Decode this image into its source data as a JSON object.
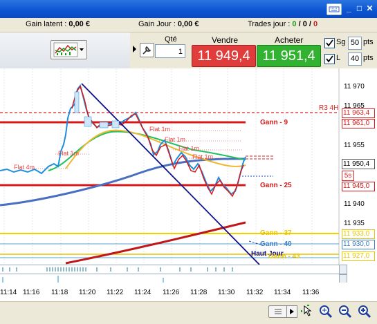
{
  "window": {
    "keyboard_icon": "keyboard-icon",
    "minimize": "_",
    "maximize": "□",
    "close": "✕"
  },
  "status": {
    "gain_latent_label": "Gain latent :",
    "gain_latent_value": "0,00 €",
    "gain_jour_label": "Gain Jour :",
    "gain_jour_value": "0,00 €",
    "trades_label": "Trades jour :",
    "trades_a": "0",
    "trades_b": "0",
    "trades_c": "0"
  },
  "order": {
    "qty_label": "Qté",
    "qty_value": "1",
    "sell_label": "Vendre",
    "sell_price": "11 949,4",
    "buy_label": "Acheter",
    "buy_price": "11 951,4",
    "sg_label": "Sg",
    "sg_value": "50",
    "l_label": "L",
    "l_value": "40",
    "pts": "pts",
    "sell_color": "#e03c3c",
    "buy_color": "#31b331"
  },
  "chart": {
    "y_ticks": [
      "11 970",
      "11 965",
      "11 955",
      "11 940",
      "11 935"
    ],
    "x_ticks": [
      "11:14",
      "11:16",
      "11:18",
      "11:20",
      "11:22",
      "11:24",
      "11:26",
      "11:28",
      "11:30",
      "11:32",
      "11:34",
      "11:36"
    ],
    "price_labels": {
      "r3": "11 963,4",
      "gann9": "11 961,0",
      "last": "11 950,4",
      "timer": "5s",
      "gann25": "11 945,0",
      "gann37": "11 933,0",
      "gann40": "11 930,0",
      "haut": "11 927,0"
    },
    "annotations": {
      "r3": "R3 4H",
      "gann9": "Gann - 9",
      "gann25": "Gann - 25",
      "gann37": "Gann - 37",
      "gann40": "Gann - 40",
      "haut": "Haut Jour",
      "gann43": "Gann - 43",
      "flat1": "Flat 4m",
      "flat2": "Flat 1m",
      "flat3": "Flat 1m",
      "flat4": "Flat 1m",
      "flat5": "Flat 1m",
      "flat6": "Flat 1m"
    }
  }
}
